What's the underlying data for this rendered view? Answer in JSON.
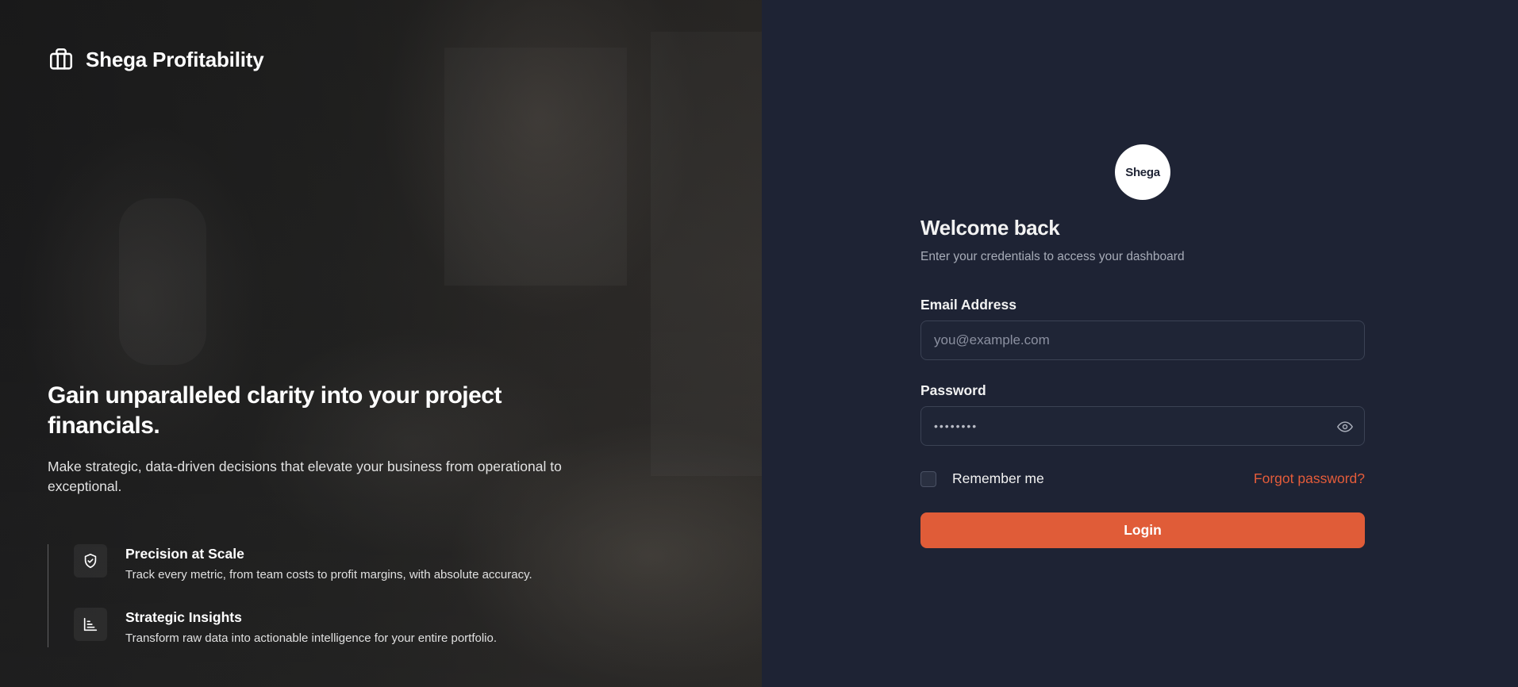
{
  "brand": {
    "name": "Shega Profitability",
    "icon": "briefcase-icon"
  },
  "hero": {
    "title": "Gain unparalleled clarity into your project financials.",
    "subtitle": "Make strategic, data-driven decisions that elevate your business from operational to exceptional."
  },
  "features": [
    {
      "icon": "shield-check-icon",
      "title": "Precision at Scale",
      "description": "Track every metric, from team costs to profit margins, with absolute accuracy."
    },
    {
      "icon": "bar-chart-icon",
      "title": "Strategic Insights",
      "description": "Transform raw data into actionable intelligence for your entire portfolio."
    }
  ],
  "login": {
    "logo_text": "Shega",
    "title": "Welcome back",
    "subtitle": "Enter your credentials to access your dashboard",
    "email_label": "Email Address",
    "email_placeholder": "you@example.com",
    "password_label": "Password",
    "password_value": "••••••••",
    "remember_label": "Remember me",
    "remember_checked": false,
    "forgot_label": "Forgot password?",
    "submit_label": "Login"
  },
  "colors": {
    "accent": "#e05c38",
    "panel_bg": "#1e2334",
    "input_border": "#3b4254"
  }
}
